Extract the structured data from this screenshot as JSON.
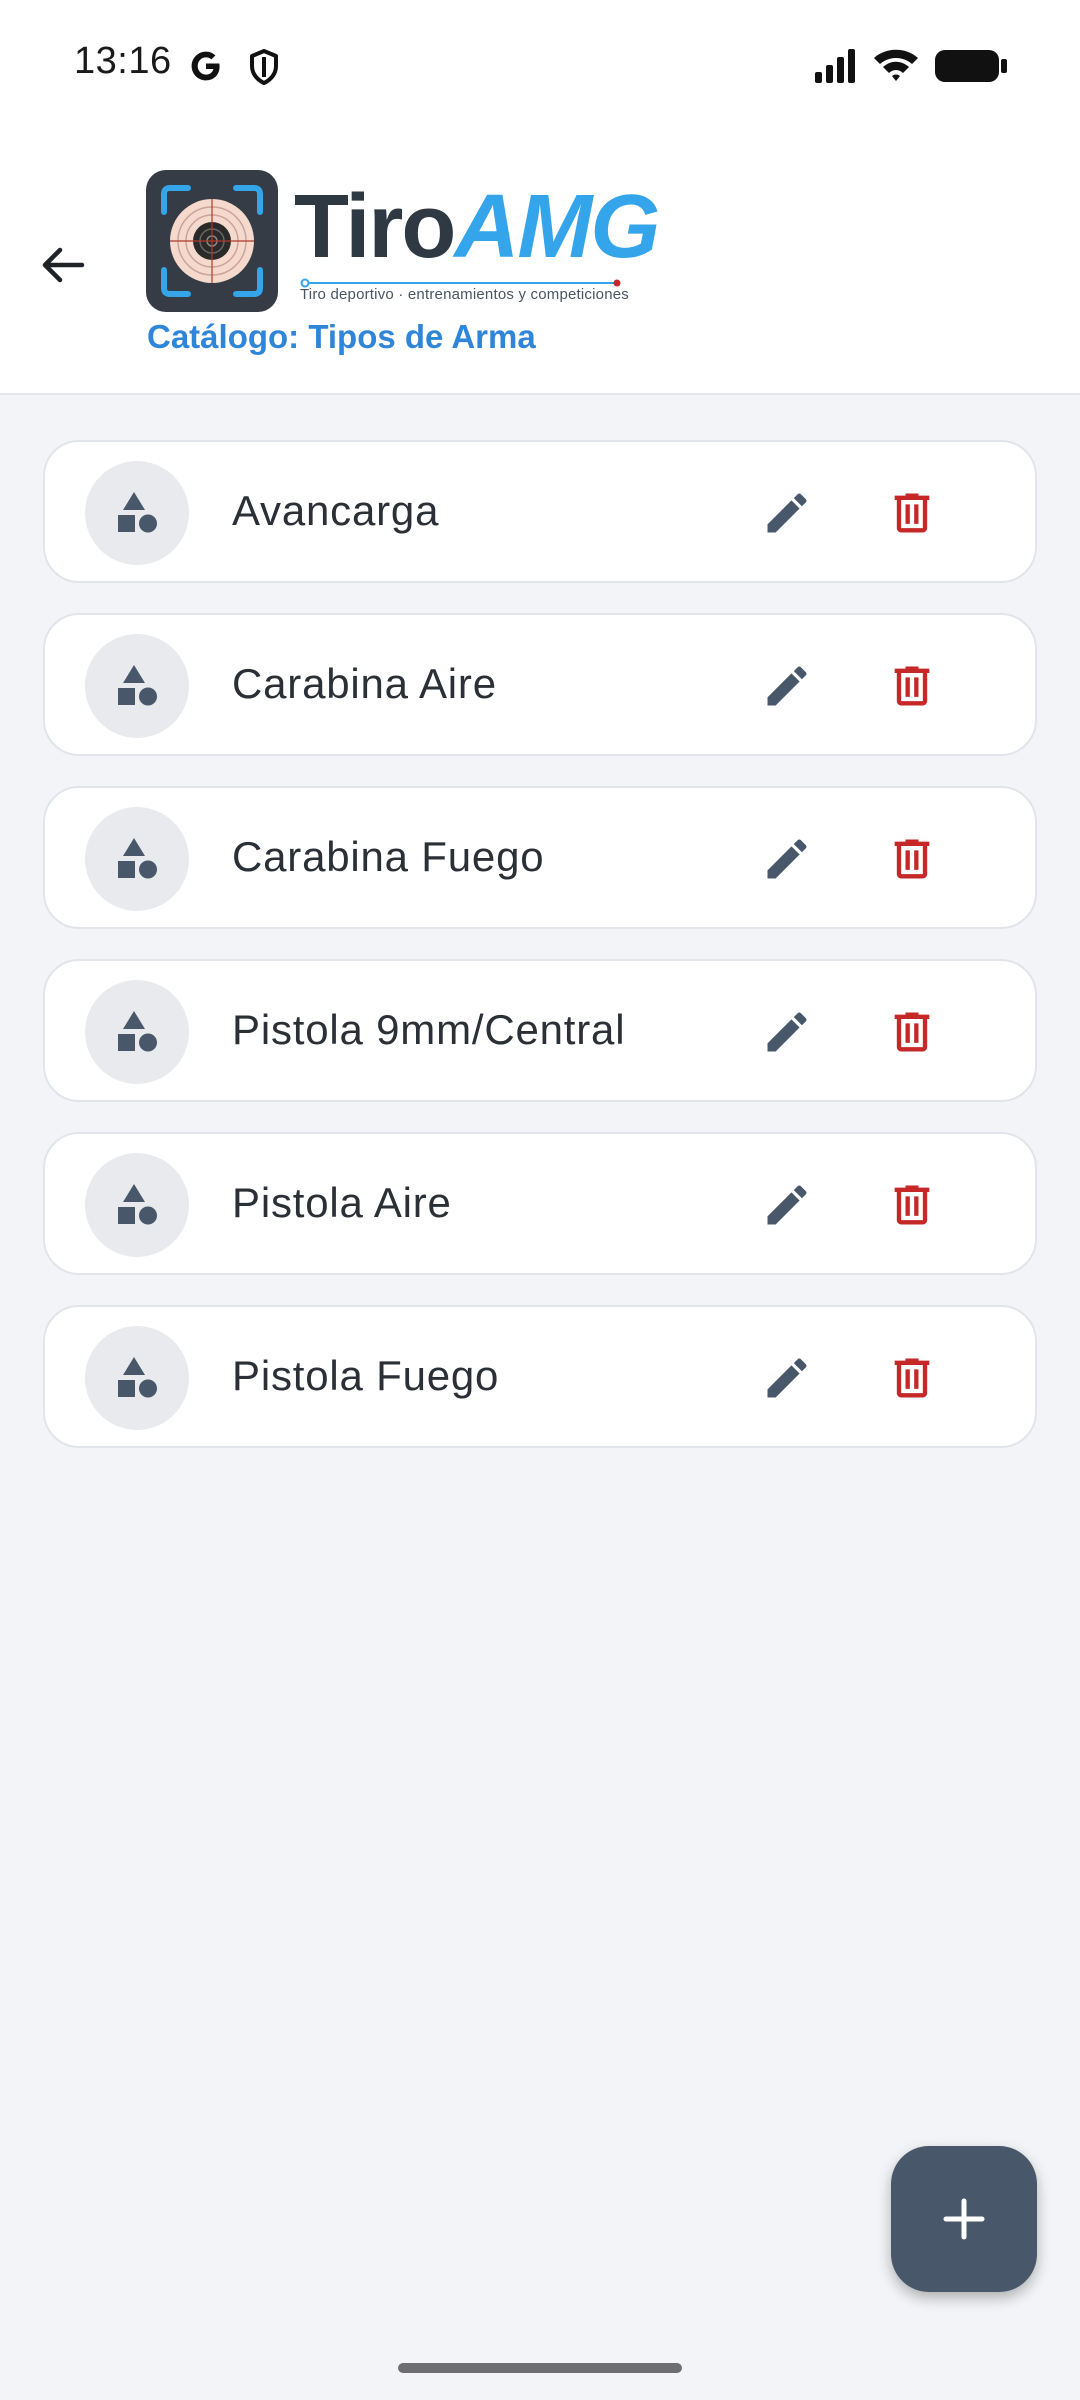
{
  "status_bar": {
    "time": "13:16",
    "icons": [
      "google-icon",
      "shield-icon",
      "signal-icon",
      "wifi-icon",
      "battery-icon"
    ]
  },
  "header": {
    "back_icon": "arrow-left-icon",
    "logo": {
      "word_dark": "Tiro",
      "word_blue": "AMG",
      "tagline": "Tiro deportivo · entrenamientos y competiciones"
    },
    "title": "Catálogo: Tipos de Arma"
  },
  "list": {
    "items": [
      {
        "label": "Avancarga"
      },
      {
        "label": "Carabina Aire"
      },
      {
        "label": "Carabina Fuego"
      },
      {
        "label": "Pistola 9mm/Central"
      },
      {
        "label": "Pistola Aire"
      },
      {
        "label": "Pistola Fuego"
      }
    ],
    "item_icon": "category-shapes-icon",
    "edit_icon": "pencil-icon",
    "delete_icon": "trash-icon"
  },
  "fab": {
    "icon": "plus-icon"
  },
  "colors": {
    "accent": "#2f86d8",
    "logo_blue": "#34a4eb",
    "icon_dark": "#48586a",
    "delete_red": "#c62828",
    "background": "#f2f4f7"
  }
}
